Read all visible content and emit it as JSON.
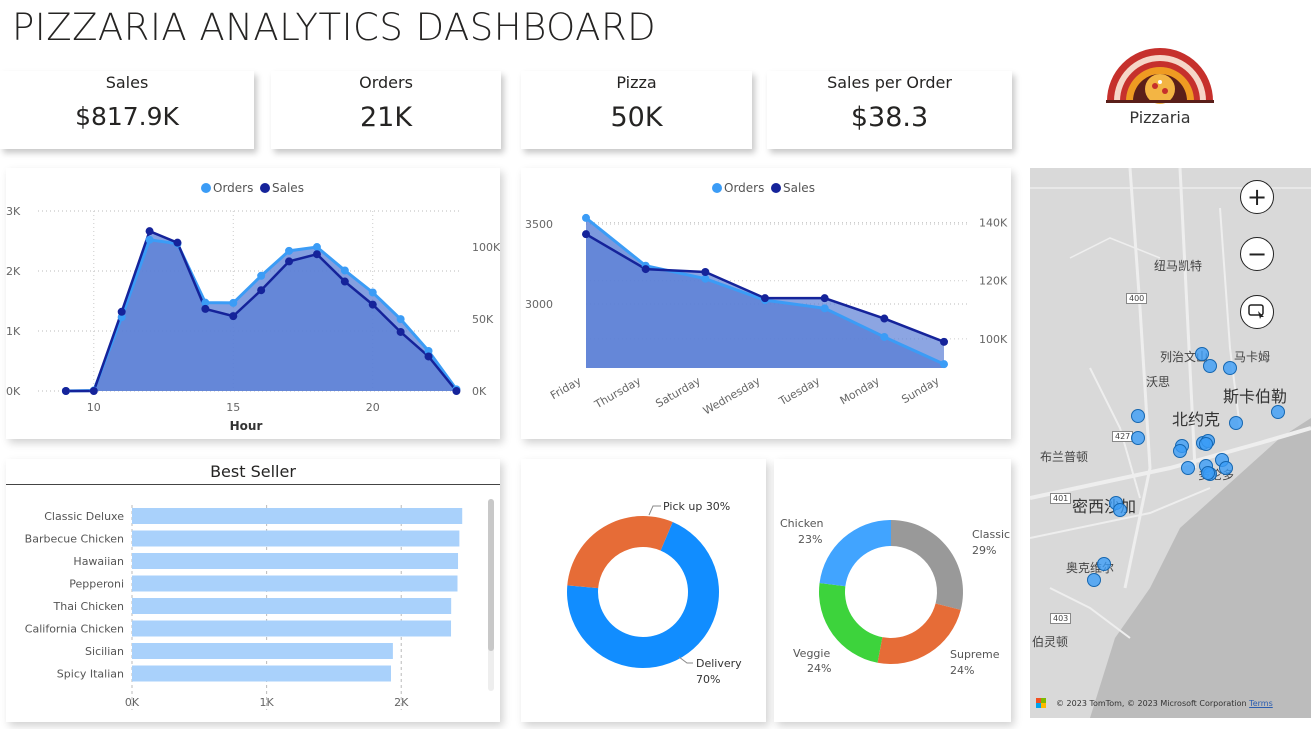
{
  "dashboard": {
    "title": "PIZZARIA ANALYTICS DASHBOARD"
  },
  "kpis": [
    {
      "label": "Sales",
      "value": "$817.9K"
    },
    {
      "label": "Orders",
      "value": "21K"
    },
    {
      "label": "Pizza",
      "value": "50K"
    },
    {
      "label": "Sales per Order",
      "value": "$38.3"
    }
  ],
  "logo": {
    "text": "Pizzaria",
    "icon": "pizza-oven-icon"
  },
  "colors": {
    "orders": "#3b9cf6",
    "sales": "#15239a",
    "area": "#5b7fd6",
    "bar": "#a9d1fb",
    "pickup": "#e66c37",
    "delivery": "#118dff",
    "chicken": "#41a4ff",
    "classic": "#999999",
    "supreme": "#e66c37",
    "veggie": "#3dd33c"
  },
  "hourly_chart": {
    "legend": [
      "Orders",
      "Sales"
    ],
    "xlabel": "Hour",
    "left_ticks": [
      "3K",
      "2K",
      "1K",
      "0K"
    ],
    "right_ticks": [
      "100K",
      "50K",
      "0K"
    ],
    "x_ticks": [
      "10",
      "15",
      "20"
    ]
  },
  "weekday_chart": {
    "legend": [
      "Orders",
      "Sales"
    ],
    "left_ticks": [
      "3500",
      "3000"
    ],
    "right_ticks": [
      "140K",
      "120K",
      "100K"
    ],
    "days": [
      "Friday",
      "Thursday",
      "Saturday",
      "Wednesday",
      "Tuesday",
      "Monday",
      "Sunday"
    ]
  },
  "best_seller": {
    "title": "Best Seller",
    "axis": [
      "0K",
      "1K",
      "2K"
    ]
  },
  "donut_order_type": {
    "labels": [
      {
        "name": "Pick up 30%"
      },
      {
        "name": "Delivery",
        "pct": "70%"
      }
    ]
  },
  "donut_category": {
    "labels": [
      {
        "name": "Chicken",
        "pct": "23%"
      },
      {
        "name": "Classic",
        "pct": "29%"
      },
      {
        "name": "Supreme",
        "pct": "24%"
      },
      {
        "name": "Veggie",
        "pct": "24%"
      }
    ]
  },
  "map": {
    "labels": [
      "纽马凯特",
      "列治文山",
      "马卡姆",
      "沃思",
      "斯卡伯勒",
      "北约克",
      "布兰普顿",
      "多伦多",
      "密西沙加",
      "奥克维尔",
      "伯灵顿"
    ],
    "road_numbers": [
      "400",
      "427",
      "401",
      "403"
    ],
    "credit": "© 2023 TomTom, © 2023 Microsoft Corporation",
    "terms": "Terms",
    "controls": [
      "zoom-in",
      "zoom-out",
      "select"
    ]
  },
  "chart_data": [
    {
      "type": "area",
      "title": "",
      "xlabel": "Hour",
      "x": [
        9,
        10,
        11,
        12,
        13,
        14,
        15,
        16,
        17,
        18,
        19,
        20,
        21,
        22,
        23
      ],
      "series": [
        {
          "name": "Orders",
          "axis": "left",
          "values": [
            1,
            8,
            1231,
            2520,
            2455,
            1472,
            1468,
            1920,
            2336,
            2399,
            2009,
            1642,
            1198,
            667,
            28
          ]
        },
        {
          "name": "Sales",
          "axis": "right",
          "values": [
            0,
            0,
            55000,
            111000,
            103000,
            57000,
            52000,
            70000,
            90000,
            95000,
            76000,
            60000,
            41000,
            24000,
            0
          ]
        }
      ],
      "ylim": [
        0,
        3000
      ],
      "y2lim": [
        0,
        125000
      ]
    },
    {
      "type": "area",
      "title": "",
      "categories": [
        "Friday",
        "Thursday",
        "Saturday",
        "Wednesday",
        "Tuesday",
        "Monday",
        "Sunday"
      ],
      "series": [
        {
          "name": "Orders",
          "axis": "left",
          "values": [
            3538,
            3239,
            3158,
            3024,
            2973,
            2794,
            2624
          ]
        },
        {
          "name": "Sales",
          "axis": "right",
          "values": [
            136000,
            124000,
            123000,
            114000,
            114000,
            107000,
            99000
          ]
        }
      ],
      "ylim": [
        2600,
        3600
      ],
      "y2lim": [
        90000,
        145000
      ]
    },
    {
      "type": "bar",
      "title": "Best Seller",
      "orientation": "horizontal",
      "categories": [
        "Classic Deluxe",
        "Barbecue Chicken",
        "Hawaiian",
        "Pepperoni",
        "Thai Chicken",
        "California Chicken",
        "Sicilian",
        "Spicy Italian"
      ],
      "values": [
        2453,
        2432,
        2422,
        2418,
        2371,
        2370,
        1938,
        1924
      ],
      "xlim": [
        0,
        2600
      ]
    },
    {
      "type": "pie",
      "donut": true,
      "categories": [
        "Delivery",
        "Pick up"
      ],
      "values": [
        70,
        30
      ]
    },
    {
      "type": "pie",
      "donut": true,
      "categories": [
        "Classic",
        "Supreme",
        "Veggie",
        "Chicken"
      ],
      "values": [
        29,
        24,
        24,
        23
      ]
    }
  ]
}
